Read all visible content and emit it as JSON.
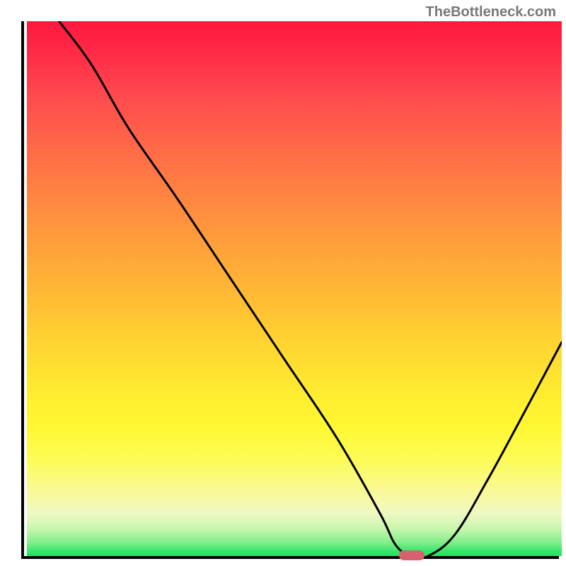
{
  "watermark": "TheBottleneck.com",
  "chart_data": {
    "type": "line",
    "title": "",
    "xlabel": "",
    "ylabel": "",
    "xlim": [
      0,
      100
    ],
    "ylim": [
      0,
      100
    ],
    "series": [
      {
        "name": "curve",
        "x": [
          6,
          12,
          19,
          28,
          38,
          48,
          58,
          66,
          69,
          72,
          75,
          80,
          86,
          92,
          100
        ],
        "y": [
          100,
          92,
          80,
          67,
          52,
          37,
          22,
          8,
          2,
          0,
          0,
          4,
          14,
          25,
          40
        ]
      }
    ],
    "marker": {
      "x": 72,
      "y": 0,
      "color": "#d7626e"
    },
    "background_gradient": {
      "top": "#ff183f",
      "mid": "#ffeb2f",
      "bottom": "#1de55f"
    }
  }
}
